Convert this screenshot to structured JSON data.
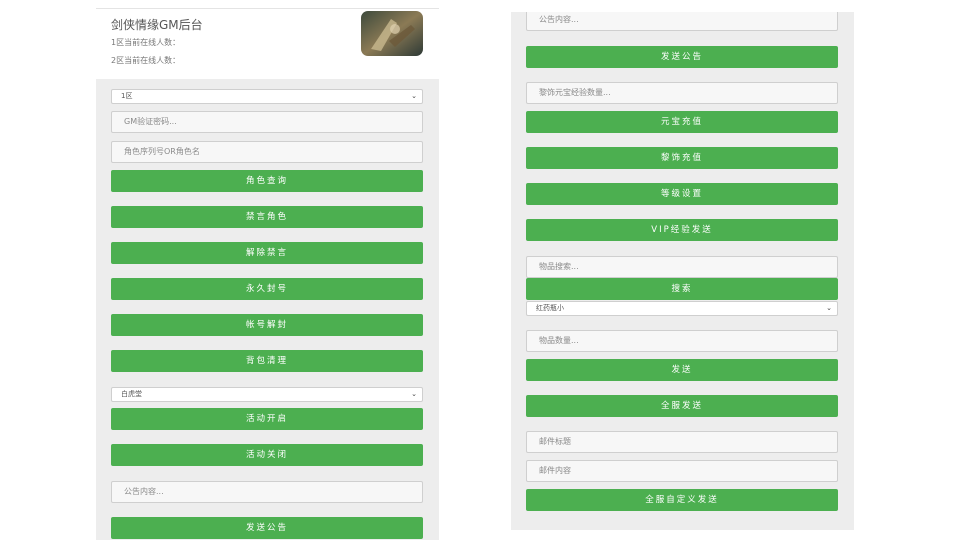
{
  "header": {
    "title": "剑侠情缘GM后台",
    "online_zone1": "1区当前在线人数：",
    "online_zone2": "2区当前在线人数："
  },
  "left": {
    "zone_select": "1区",
    "gm_password_placeholder": "GM验证密码...",
    "role_query_placeholder": "角色序列号OR角色名",
    "buttons": {
      "role_query": "角色查询",
      "mute_role": "禁言角色",
      "unmute": "解除禁言",
      "perm_ban": "永久封号",
      "unban": "帐号解封",
      "clear_bag": "背包清理"
    },
    "activity_select": "白虎堂",
    "activity_open": "活动开启",
    "activity_close": "活动关闭",
    "announcement_placeholder": "公告内容...",
    "send_announcement": "发送公告"
  },
  "right": {
    "announcement_placeholder": "公告内容...",
    "send_announcement": "发送公告",
    "amount_placeholder": "黎饰元宝经验数量...",
    "yuanbao_recharge": "元宝充值",
    "lishi_recharge": "黎饰充值",
    "level_set": "等级设置",
    "vip_exp_send": "VIP经验发送",
    "item_search_placeholder": "物品搜索...",
    "search": "搜索",
    "item_select": "红药瓶小",
    "item_count_placeholder": "物品数量...",
    "send": "发送",
    "server_send": "全服发送",
    "mail_title_placeholder": "邮件标题",
    "mail_content_placeholder": "邮件内容",
    "server_custom_send": "全服自定义发送"
  },
  "colors": {
    "button_green": "#4caf50",
    "panel_bg": "#ededed"
  },
  "icons": {
    "select_arrow": "chevron-down-icon"
  }
}
